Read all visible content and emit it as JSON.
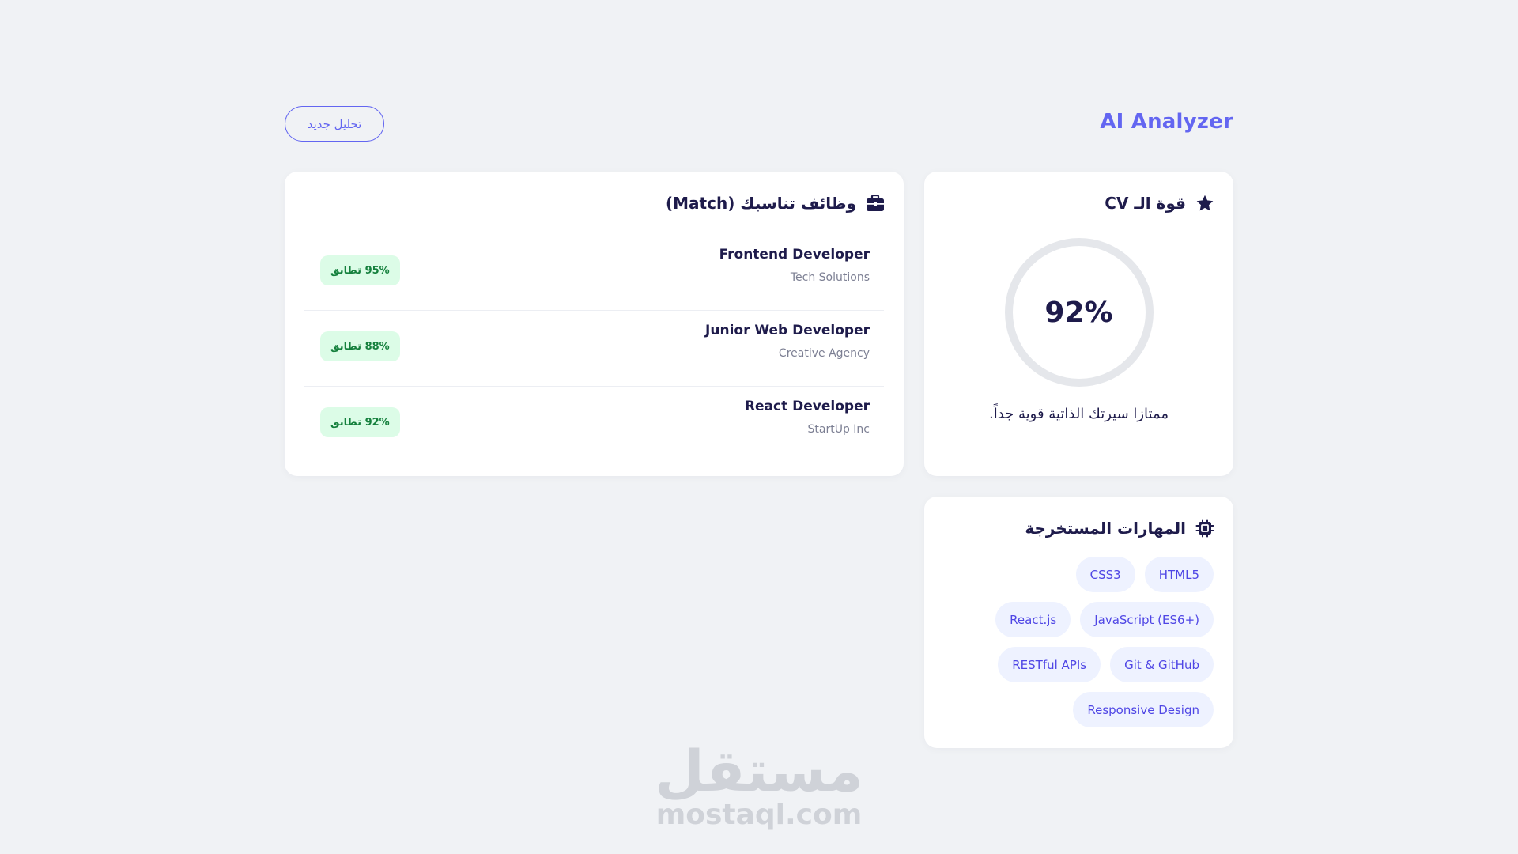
{
  "header": {
    "brand": "AI Analyzer",
    "new_analysis_label": "تحليل جديد"
  },
  "cv_strength": {
    "title": "قوة الـ CV",
    "icon": "star-icon",
    "score_percent": 92,
    "score_label": "92%",
    "caption": "ممتازا سيرتك الذاتية قوية جداً."
  },
  "jobs": {
    "title": "وظائف تناسبك (Match)",
    "icon": "briefcase-icon",
    "items": [
      {
        "title": "Frontend Developer",
        "company": "Tech Solutions",
        "match": "95% تطابق"
      },
      {
        "title": "Junior Web Developer",
        "company": "Creative Agency",
        "match": "88% تطابق"
      },
      {
        "title": "React Developer",
        "company": "StartUp Inc",
        "match": "92% تطابق"
      }
    ]
  },
  "skills": {
    "title": "المهارات المستخرجة",
    "icon": "chip-icon",
    "items": [
      "HTML5",
      "CSS3",
      "JavaScript (ES6+)",
      "React.js",
      "Git & GitHub",
      "RESTful APIs",
      "Responsive Design"
    ]
  },
  "watermark": {
    "arabic": "مستقل",
    "latin": "mostaql.com"
  },
  "colors": {
    "accent": "#6366f1",
    "track": "#e5e7eb",
    "badge_bg": "#dcfce7",
    "badge_text": "#15803d",
    "chip_bg": "#eef2ff",
    "background": "#f0f2f5"
  }
}
